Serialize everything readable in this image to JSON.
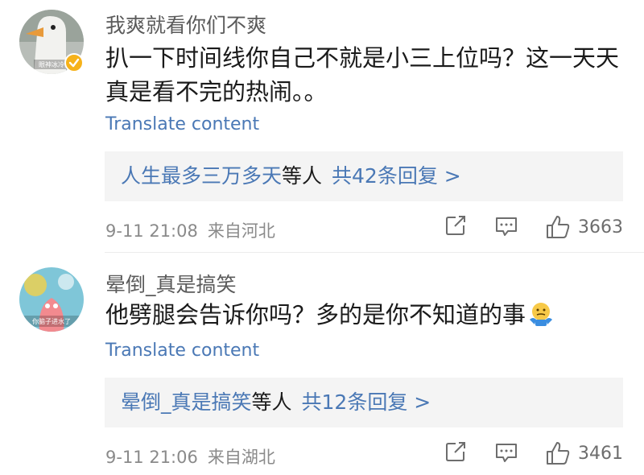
{
  "comments": [
    {
      "username": "我爽就看你们不爽",
      "avatar_text": "眼神冰冷",
      "text": "扒一下时间线你自己不就是小三上位吗？这一天天真是看不完的热闹。。",
      "translate_label": "Translate content",
      "replies": {
        "name": "人生最多三万多天",
        "mid": "等人",
        "count_label": "共42条回复 >"
      },
      "time": "9-11 21:08",
      "location": "来自河北",
      "likes": "3663"
    },
    {
      "username": "晕倒_真是搞笑",
      "avatar_text": "你脑子进水了",
      "text": "他劈腿会告诉你吗？多的是你不知道的事",
      "text_emoji": "shrug-emoji",
      "translate_label": "Translate content",
      "replies": {
        "name": "晕倒_真是搞笑",
        "mid": "等人",
        "count_label": "共12条回复 >"
      },
      "time": "9-11 21:06",
      "location": "来自湖北",
      "likes": "3461"
    }
  ],
  "icons": [
    "share-icon",
    "reply-icon",
    "like-icon",
    "verified-badge-icon"
  ],
  "colors": {
    "link": "#4a78b5",
    "meta": "#8a8a8a",
    "reply_bg": "#f4f4f4",
    "badge": "#f6b21a"
  }
}
